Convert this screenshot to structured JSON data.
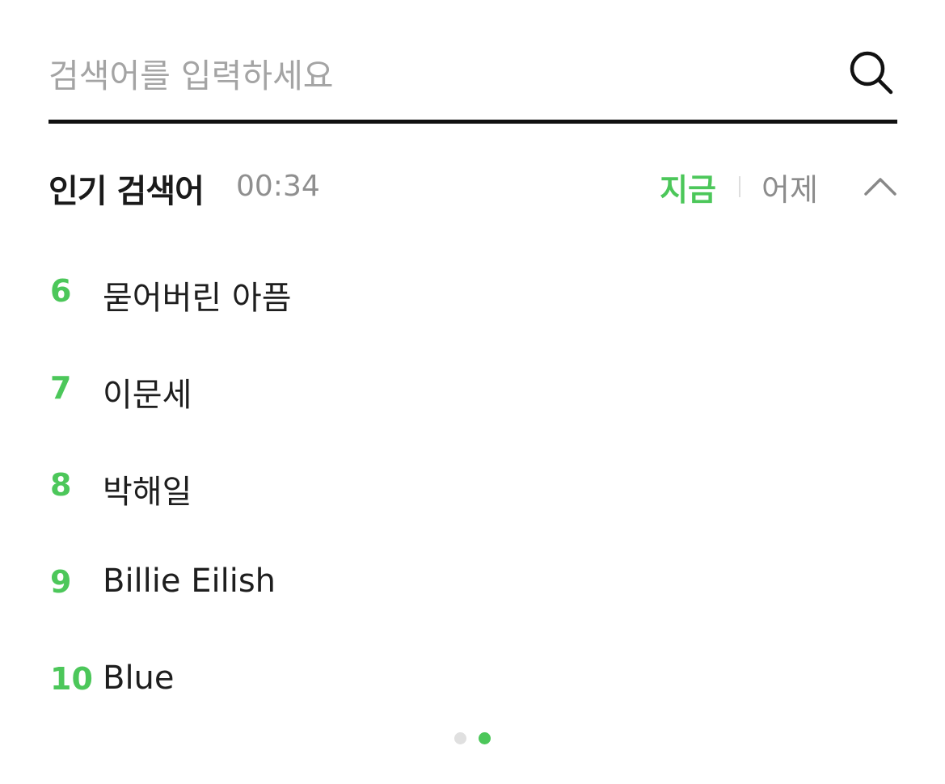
{
  "search": {
    "placeholder": "검색어를 입력하세요",
    "value": "",
    "icon": "search-icon"
  },
  "popular": {
    "title": "인기 검색어",
    "time": "00:34",
    "tabs": [
      {
        "label": "지금",
        "active": true
      },
      {
        "label": "어제",
        "active": false
      }
    ],
    "collapse_icon": "chevron-up-icon",
    "items": [
      {
        "rank": "6",
        "text": "묻어버린 아픔"
      },
      {
        "rank": "7",
        "text": "이문세"
      },
      {
        "rank": "8",
        "text": "박해일"
      },
      {
        "rank": "9",
        "text": "Billie Eilish"
      },
      {
        "rank": "10",
        "text": "Blue"
      }
    ]
  },
  "pager": {
    "pages": 2,
    "current": 2
  },
  "colors": {
    "accent": "#4cc75a",
    "text": "#1e1e1e",
    "muted": "#8f8f8f",
    "underline": "#111111"
  }
}
